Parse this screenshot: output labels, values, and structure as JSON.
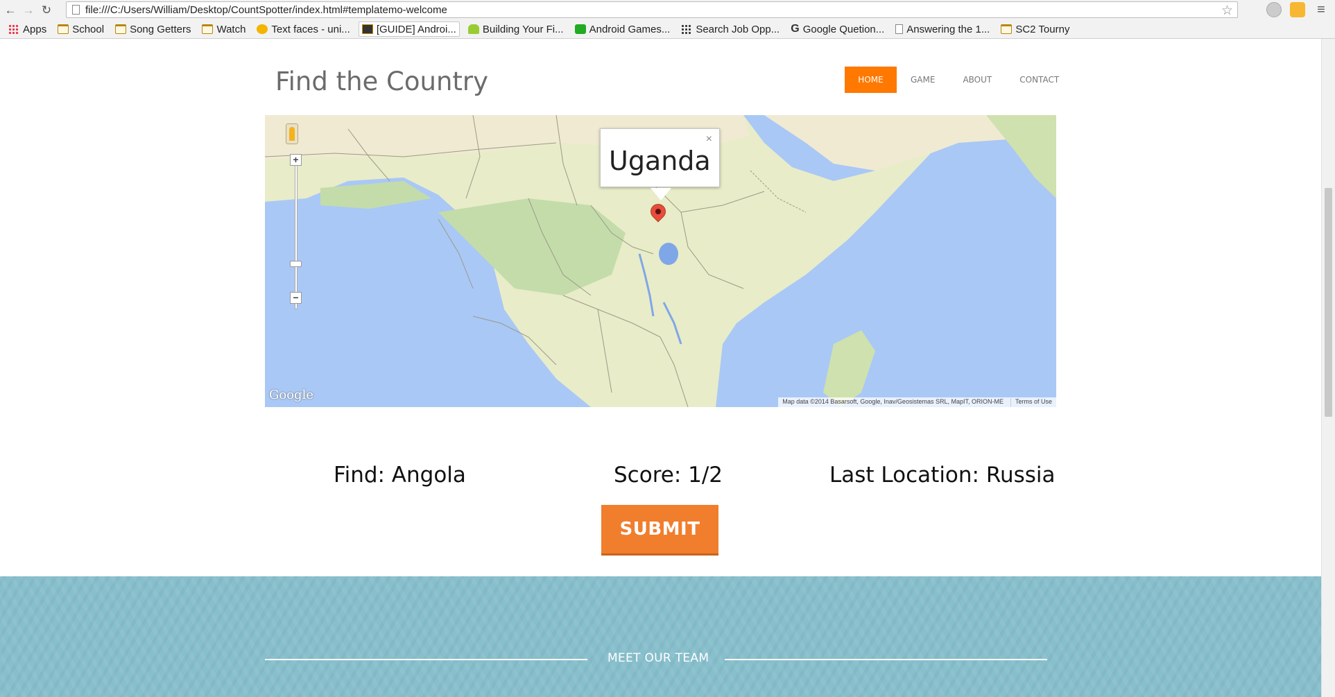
{
  "browser": {
    "url": "file:///C:/Users/William/Desktop/CountSpotter/index.html#templatemo-welcome",
    "bookmarks": [
      {
        "label": "Apps",
        "icon": "apps-icon"
      },
      {
        "label": "School",
        "icon": "folder-icon"
      },
      {
        "label": "Song Getters",
        "icon": "folder-icon"
      },
      {
        "label": "Watch",
        "icon": "folder-icon"
      },
      {
        "label": "Text faces - uni...",
        "icon": "smiley-face-icon"
      },
      {
        "label": "[GUIDE] Androi...",
        "icon": "guide-favicon-icon"
      },
      {
        "label": "Building Your Fi...",
        "icon": "android-icon"
      },
      {
        "label": "Android Games...",
        "icon": "gamepad-icon"
      },
      {
        "label": "Search Job Opp...",
        "icon": "dots-icon"
      },
      {
        "label": "Google Quetion...",
        "icon": "google-g-icon"
      },
      {
        "label": "Answering the 1...",
        "icon": "document-icon"
      },
      {
        "label": "SC2 Tourny",
        "icon": "folder-icon"
      }
    ]
  },
  "site": {
    "title": "Find the Country",
    "nav": [
      {
        "label": "HOME",
        "active": true
      },
      {
        "label": "GAME",
        "active": false
      },
      {
        "label": "ABOUT",
        "active": false
      },
      {
        "label": "CONTACT",
        "active": false
      }
    ]
  },
  "map": {
    "infowindow_text": "Uganda",
    "close_glyph": "×",
    "logo": "Google",
    "attribution": "Map data ©2014 Basarsoft, Google, Inav/Geosistemas SRL, MapIT, ORION-ME",
    "terms": "Terms of Use",
    "zoom_in": "+",
    "zoom_out": "−",
    "colors": {
      "water": "#a9c8f6",
      "land": "#e8ecc8",
      "forest": "#c4dcaa",
      "desert": "#f0ead2",
      "border": "#9a9a88",
      "marker": "#e74c3c"
    }
  },
  "game": {
    "find_text": "Find: Angola",
    "score_text": "Score: 1/2",
    "last_location_text": "Last Location: Russia",
    "submit_label": "SUBMIT",
    "accent": "#f07e2d"
  },
  "team": {
    "title": "MEET OUR TEAM",
    "background": "#87bfcc"
  }
}
